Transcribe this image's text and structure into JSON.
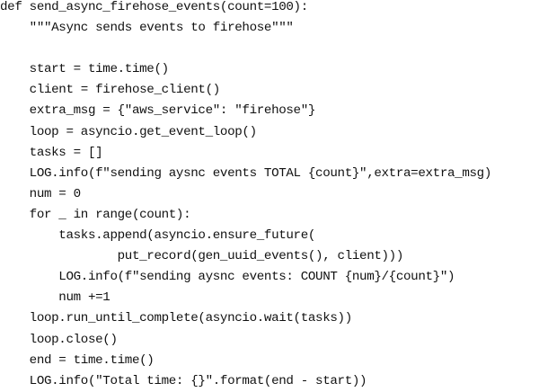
{
  "listing": {
    "lines": [
      "def send_async_firehose_events(count=100):",
      "    \"\"\"Async sends events to firehose\"\"\"",
      "",
      "    start = time.time()",
      "    client = firehose_client()",
      "    extra_msg = {\"aws_service\": \"firehose\"}",
      "    loop = asyncio.get_event_loop()",
      "    tasks = []",
      "    LOG.info(f\"sending aysnc events TOTAL {count}\",extra=extra_msg)",
      "    num = 0",
      "    for _ in range(count):",
      "        tasks.append(asyncio.ensure_future(",
      "                put_record(gen_uuid_events(), client)))",
      "        LOG.info(f\"sending aysnc events: COUNT {num}/{count}\")",
      "        num +=1",
      "    loop.run_until_complete(asyncio.wait(tasks))",
      "    loop.close()",
      "    end = time.time()",
      "    LOG.info(\"Total time: {}\".format(end - start))"
    ]
  }
}
